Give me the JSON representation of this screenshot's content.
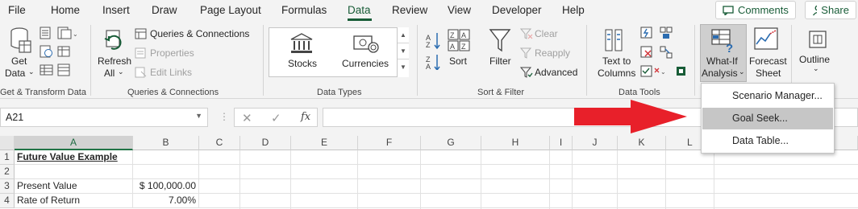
{
  "menu": {
    "tabs": [
      "File",
      "Home",
      "Insert",
      "Draw",
      "Page Layout",
      "Formulas",
      "Data",
      "Review",
      "View",
      "Developer",
      "Help"
    ],
    "active_tab": "Data",
    "comments_label": "Comments",
    "share_label": "Share"
  },
  "ribbon": {
    "get_transform": {
      "get_data_line1": "Get",
      "get_data_line2": "Data",
      "group_label": "Get & Transform Data"
    },
    "queries": {
      "refresh_line1": "Refresh",
      "refresh_line2": "All",
      "queries_connections": "Queries & Connections",
      "properties": "Properties",
      "edit_links": "Edit Links",
      "group_label": "Queries & Connections"
    },
    "data_types": {
      "stocks": "Stocks",
      "currencies": "Currencies",
      "group_label": "Data Types"
    },
    "sort_filter": {
      "sort": "Sort",
      "filter": "Filter",
      "clear": "Clear",
      "reapply": "Reapply",
      "advanced": "Advanced",
      "group_label": "Sort & Filter"
    },
    "data_tools": {
      "text_to_columns_line1": "Text to",
      "text_to_columns_line2": "Columns",
      "group_label": "Data Tools"
    },
    "forecast": {
      "whatif_line1": "What-If",
      "whatif_line2": "Analysis",
      "forecast_line1": "Forecast",
      "forecast_line2": "Sheet"
    },
    "outline": {
      "label": "Outline"
    }
  },
  "formula_bar": {
    "name_box": "A21",
    "fx_label": "fx"
  },
  "grid": {
    "columns": [
      "A",
      "B",
      "C",
      "D",
      "E",
      "F",
      "G",
      "H",
      "I",
      "J",
      "K",
      "L"
    ],
    "rows": [
      {
        "num": "1",
        "a": "Future Value Example",
        "b": ""
      },
      {
        "num": "2",
        "a": "",
        "b": ""
      },
      {
        "num": "3",
        "a": "Present Value",
        "b": "$ 100,000.00"
      },
      {
        "num": "4",
        "a": "Rate of Return",
        "b": "7.00%"
      }
    ]
  },
  "dropdown": {
    "items": [
      "Scenario Manager...",
      "Goal Seek...",
      "Data Table..."
    ],
    "highlighted": "Goal Seek..."
  },
  "colors": {
    "excel_green": "#185c37",
    "annotation_arrow": "#e8202a"
  }
}
